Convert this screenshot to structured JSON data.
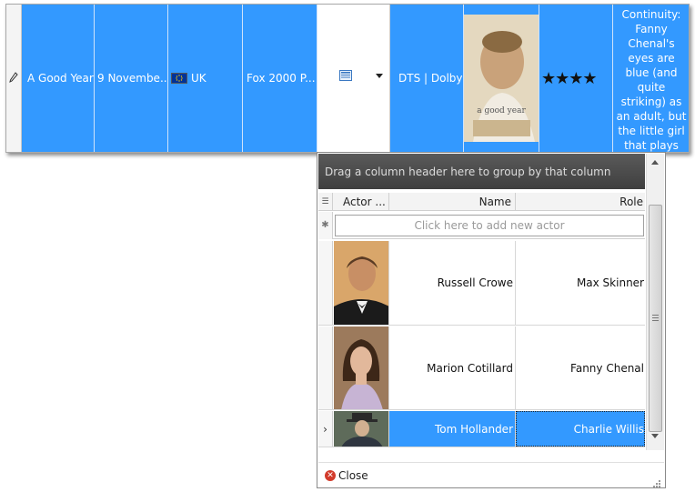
{
  "movie_row": {
    "row_indicator_icon": "pencil-edit-icon",
    "title": "A Good Year",
    "release_date": "9 Novembe...",
    "country": "UK",
    "country_flag_icon": "eu-flag-icon",
    "studio": "Fox 2000 P...",
    "subtitles_icon": "list-icon",
    "audio": "DTS | Dolby",
    "poster_alt": "a good year",
    "rating_stars": "★★★★",
    "rating_value": 4,
    "notes": "Continuity: Fanny Chenal's eyes are blue (and quite striking) as an adult, but the little girl that plays"
  },
  "actors_popup": {
    "group_panel_text": "Drag a column header here to group by that column",
    "columns": [
      "Actor ...",
      "Name",
      "Role"
    ],
    "new_row_placeholder": "Click here to add new actor",
    "new_row_indicator": "✱",
    "rows": [
      {
        "name": "Russell Crowe",
        "role": "Max Skinner",
        "selected": false
      },
      {
        "name": "Marion Cotillard",
        "role": "Fanny Chenal",
        "selected": false
      },
      {
        "name": "Tom Hollander",
        "role": "Charlie Willis",
        "selected": true
      }
    ],
    "current_row_indicator": "›",
    "close_label": "Close"
  },
  "colors": {
    "selection": "#3399ff",
    "group_panel": "#4a4a4a",
    "close_icon": "#d23b2b"
  }
}
